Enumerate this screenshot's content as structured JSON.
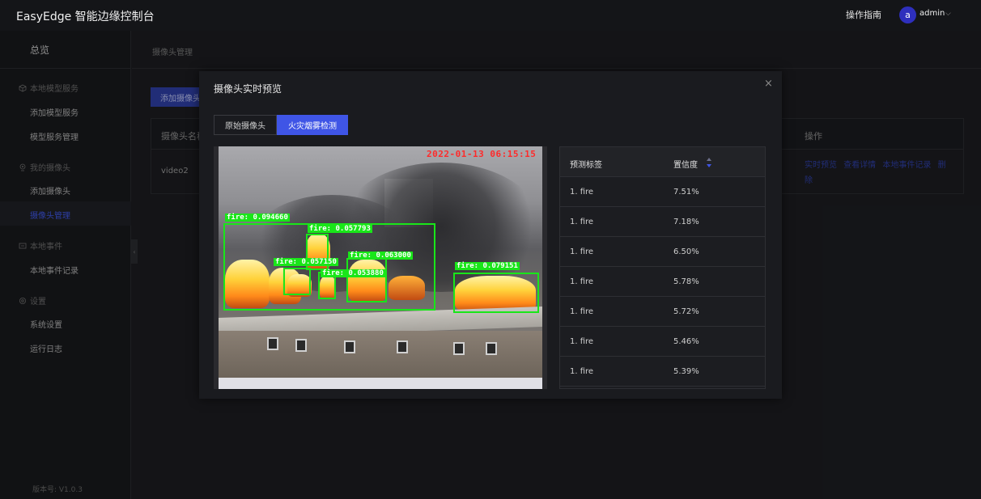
{
  "header": {
    "brand": "EasyEdge 智能边缘控制台",
    "guide": "操作指南",
    "avatar_letter": "a",
    "user": "admin"
  },
  "sidebar": {
    "overview": "总览",
    "groups": [
      {
        "label": "本地模型服务",
        "icon": "cube-icon",
        "items": [
          "添加模型服务",
          "模型服务管理"
        ]
      },
      {
        "label": "我的摄像头",
        "icon": "camera-icon",
        "items": [
          "添加摄像头",
          "摄像头管理"
        ]
      },
      {
        "label": "本地事件",
        "icon": "event-icon",
        "items": [
          "本地事件记录"
        ]
      },
      {
        "label": "设置",
        "icon": "gear-icon",
        "items": [
          "系统设置",
          "运行日志"
        ]
      }
    ],
    "active_item": "摄像头管理",
    "version": "版本号: V1.0.3"
  },
  "main": {
    "breadcrumb": "摄像头管理",
    "add_button": "添加摄像头",
    "table": {
      "col_name": "摄像头名称",
      "col_ops": "操作",
      "rows": [
        {
          "name": "video2",
          "ops": [
            "实时预览",
            "查看详情",
            "本地事件记录",
            "删除"
          ]
        }
      ]
    }
  },
  "modal": {
    "title": "摄像头实时预览",
    "close": "×",
    "tabs": [
      "原始摄像头",
      "火灾烟雾检测"
    ],
    "active_tab": "火灾烟雾检测",
    "timestamp": "2022-01-13 06:15:15",
    "detections": [
      {
        "label": "fire: 0.094660"
      },
      {
        "label": "fire: 0.057793"
      },
      {
        "label": "fire: 0.057150"
      },
      {
        "label": "fire: 0.063000"
      },
      {
        "label": "fire: 0.053880"
      },
      {
        "label": "fire: 0.079151"
      }
    ],
    "results": {
      "col_label": "预测标签",
      "col_conf": "置信度",
      "rows": [
        {
          "label": "1. fire",
          "conf": "7.51%"
        },
        {
          "label": "1. fire",
          "conf": "7.18%"
        },
        {
          "label": "1. fire",
          "conf": "6.50%"
        },
        {
          "label": "1. fire",
          "conf": "5.78%"
        },
        {
          "label": "1. fire",
          "conf": "5.72%"
        },
        {
          "label": "1. fire",
          "conf": "5.46%"
        },
        {
          "label": "1. fire",
          "conf": "5.39%"
        }
      ]
    }
  },
  "colors": {
    "accent": "#3f55e6",
    "detection_box": "#19e619",
    "timestamp": "#ff2a2a"
  }
}
